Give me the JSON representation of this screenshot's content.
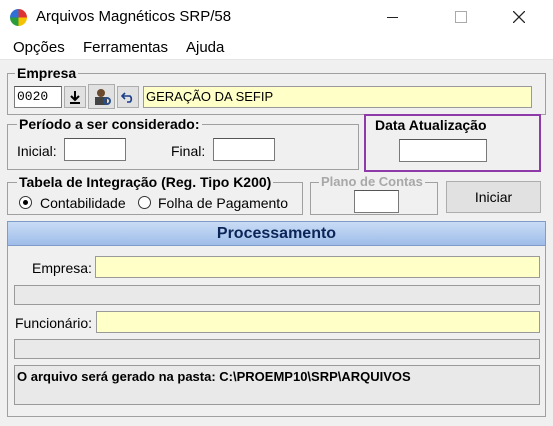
{
  "window": {
    "title": "Arquivos Magnéticos SRP/58",
    "minimize_icon": "minimize-icon",
    "maximize_icon": "maximize-icon",
    "close_icon": "close-icon"
  },
  "menu": [
    "Opções",
    "Ferramentas",
    "Ajuda"
  ],
  "empresa": {
    "label": "Empresa",
    "code": "0020",
    "name": "GERAÇÃO DA SEFIP"
  },
  "periodo": {
    "label": "Período a ser considerado:",
    "inicial_label": "Inicial:",
    "inicial_value": "",
    "final_label": "Final:",
    "final_value": ""
  },
  "data_atualizacao": {
    "label": "Data Atualização",
    "value": ""
  },
  "tabela": {
    "label": "Tabela de Integração (Reg. Tipo K200)",
    "options": [
      "Contabilidade",
      "Folha de Pagamento"
    ],
    "selected": "Contabilidade"
  },
  "plano": {
    "label": "Plano de Contas",
    "value": ""
  },
  "iniciar_label": "Iniciar",
  "processamento": {
    "header": "Processamento",
    "empresa_label": "Empresa:",
    "empresa_value": "",
    "funcionario_label": "Funcionário:",
    "funcionario_value": "",
    "status": "O arquivo será gerado na pasta: C:\\PROEMP10\\SRP\\ARQUIVOS"
  },
  "colors": {
    "highlight_border": "#8e3aa8",
    "field_yellow": "#ffffc8",
    "header_blue": "#9fbde9"
  }
}
